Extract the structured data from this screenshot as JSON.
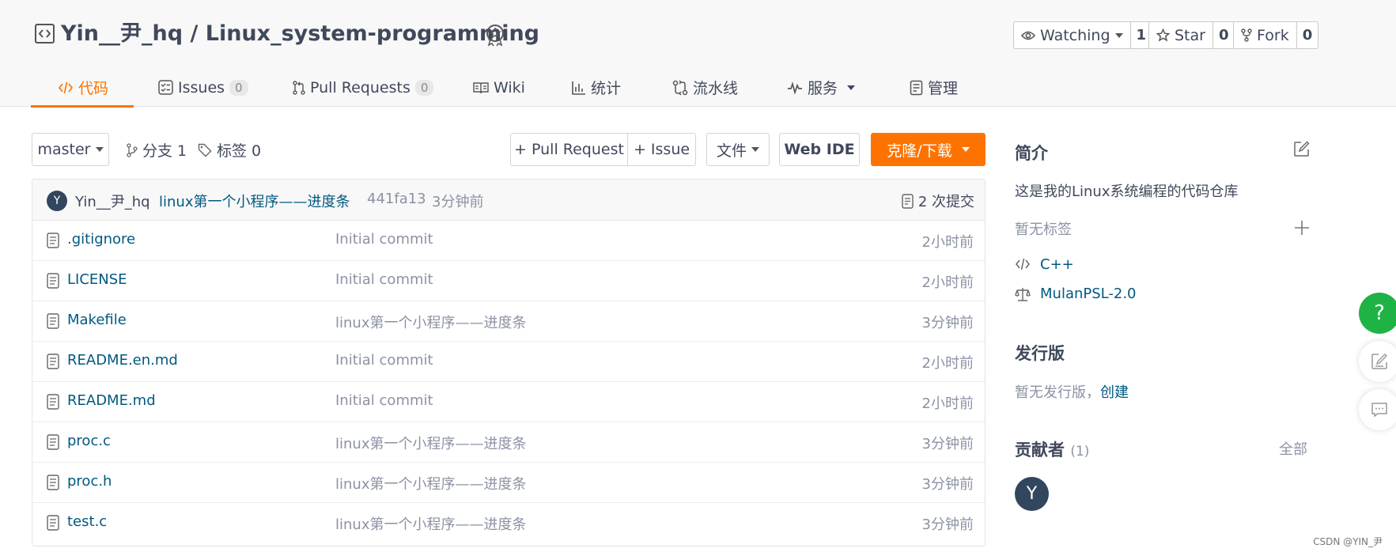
{
  "repo": {
    "owner": "Yin__尹_hq",
    "separator": " / ",
    "name": "Linux_system-programming"
  },
  "actions": [
    {
      "label": "Watching",
      "count": "1",
      "icon": "eye-icon"
    },
    {
      "label": "Star",
      "count": "0",
      "icon": "star-icon"
    },
    {
      "label": "Fork",
      "count": "0",
      "icon": "fork-icon"
    }
  ],
  "tabs": [
    {
      "label": "代码",
      "icon": "code-icon",
      "active": true
    },
    {
      "label": "Issues",
      "count": "0",
      "icon": "issues-icon"
    },
    {
      "label": "Pull Requests",
      "count": "0",
      "icon": "pull-request-icon"
    },
    {
      "label": "Wiki",
      "icon": "wiki-icon"
    },
    {
      "label": "统计",
      "icon": "chart-icon"
    },
    {
      "label": "流水线",
      "icon": "pipeline-icon"
    },
    {
      "label": "服务",
      "icon": "service-icon"
    },
    {
      "label": "管理",
      "icon": "manage-icon"
    }
  ],
  "toolbar": {
    "branch": "master",
    "branches_label": "分支 1",
    "tags_label": "标签 0",
    "pull_request": "+ Pull Request",
    "issue": "+ Issue",
    "file": "文件",
    "web_ide": "Web IDE",
    "clone": "克隆/下载"
  },
  "last_commit": {
    "avatar": "Y",
    "author": "Yin__尹_hq",
    "message": "linux第一个小程序——进度条",
    "hash": "441fa13",
    "time": "3分钟前",
    "commits": "2 次提交"
  },
  "files": [
    {
      "name": ".gitignore",
      "message": "Initial commit",
      "time": "2小时前"
    },
    {
      "name": "LICENSE",
      "message": "Initial commit",
      "time": "2小时前"
    },
    {
      "name": "Makefile",
      "message": "linux第一个小程序——进度条",
      "time": "3分钟前"
    },
    {
      "name": "README.en.md",
      "message": "Initial commit",
      "time": "2小时前"
    },
    {
      "name": "README.md",
      "message": "Initial commit",
      "time": "2小时前"
    },
    {
      "name": "proc.c",
      "message": "linux第一个小程序——进度条",
      "time": "3分钟前"
    },
    {
      "name": "proc.h",
      "message": "linux第一个小程序——进度条",
      "time": "3分钟前"
    },
    {
      "name": "test.c",
      "message": "linux第一个小程序——进度条",
      "time": "3分钟前"
    }
  ],
  "sidebar": {
    "intro_title": "简介",
    "intro_text": "这是我的Linux系统编程的代码仓库",
    "no_tags": "暂无标签",
    "language": "C++",
    "license": "MulanPSL-2.0",
    "release_title": "发行版",
    "no_release": "暂无发行版，",
    "create": "创建",
    "contributors_title": "贡献者",
    "contributors_count": "(1)",
    "all": "全部",
    "contributor_avatar": "Y"
  },
  "floating": {
    "help": "?"
  },
  "watermark": "CSDN @YIN_尹",
  "colors": {
    "accent": "#fe7300",
    "link": "#005980",
    "help": "#1fb345"
  }
}
